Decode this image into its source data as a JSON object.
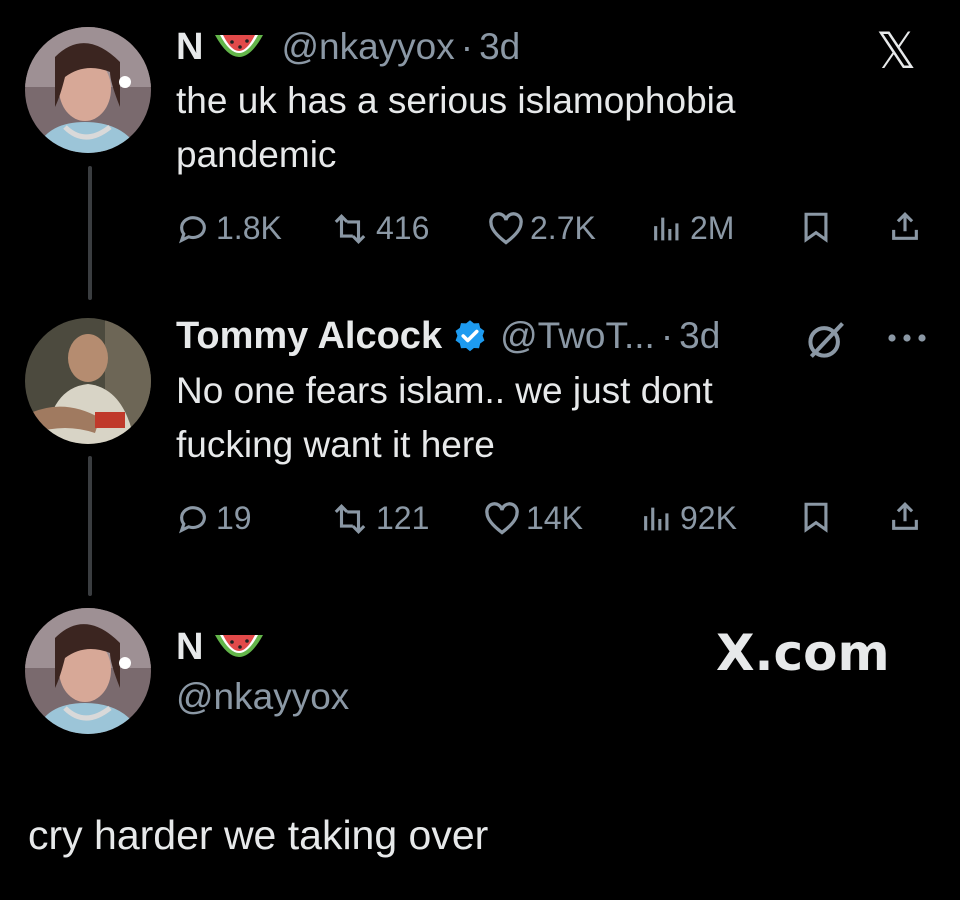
{
  "tweet1": {
    "name": "N",
    "handle": "@nkayyox",
    "sep": "·",
    "time": "3d",
    "text_line1": "the uk has a serious islamophobia",
    "text_line2": "pandemic",
    "replies": "1.8K",
    "reposts": "416",
    "likes": "2.7K",
    "views": "2M"
  },
  "tweet2": {
    "name": "Tommy Alcock",
    "handle": "@TwoT...",
    "sep": "·",
    "time": "3d",
    "text_line1": "No one fears islam.. we just dont",
    "text_line2": "fucking want it here",
    "replies": "19",
    "reposts": "121",
    "likes": "14K",
    "views": "92K"
  },
  "profile": {
    "name": "N",
    "handle": "@nkayyox"
  },
  "brand": {
    "x_logo": "𝕏",
    "watermark": "X.com"
  },
  "caption": "cry harder we taking over",
  "colors": {
    "background": "#000000",
    "text": "#e7e9ea",
    "muted": "#8b98a5",
    "verified": "#1d9bf0",
    "thread_line": "#3a3d40"
  },
  "icons": [
    "watermelon-icon",
    "verified-badge-icon",
    "reply-icon",
    "repost-icon",
    "like-icon",
    "views-icon",
    "bookmark-icon",
    "share-icon",
    "grok-icon",
    "more-icon",
    "x-logo"
  ]
}
